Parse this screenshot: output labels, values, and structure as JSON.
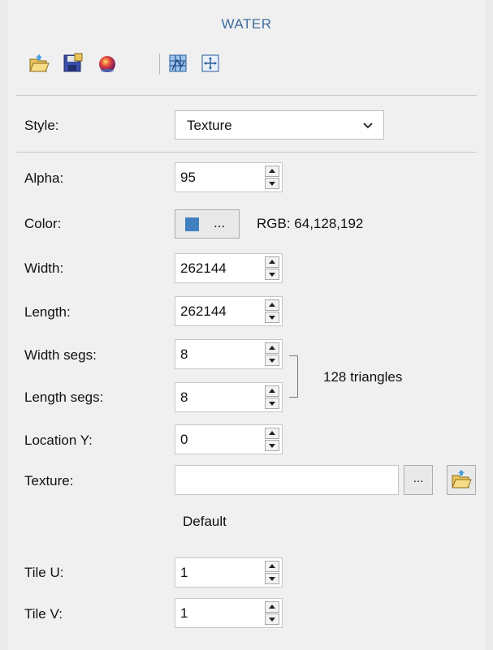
{
  "panel": {
    "title": "WATER"
  },
  "toolbar": {
    "icons": [
      "open-folder-icon",
      "save-icon",
      "color-ball-icon",
      "grid-icon",
      "move-icon"
    ]
  },
  "style": {
    "label": "Style:",
    "selected": "Texture"
  },
  "alpha": {
    "label": "Alpha:",
    "value": "95"
  },
  "color": {
    "label": "Color:",
    "button_text": "...",
    "swatch": "#4080c0",
    "rgb_text": "RGB: 64,128,192"
  },
  "width": {
    "label": "Width:",
    "value": "262144"
  },
  "length": {
    "label": "Length:",
    "value": "262144"
  },
  "width_segs": {
    "label": "Width segs:",
    "value": "8"
  },
  "length_segs": {
    "label": "Length segs:",
    "value": "8"
  },
  "triangles": "128 triangles",
  "location_y": {
    "label": "Location Y:",
    "value": "0"
  },
  "texture": {
    "label": "Texture:",
    "value": "",
    "browse_text": "...",
    "default_text": "Default"
  },
  "tile_u": {
    "label": "Tile U:",
    "value": "1"
  },
  "tile_v": {
    "label": "Tile V:",
    "value": "1"
  }
}
